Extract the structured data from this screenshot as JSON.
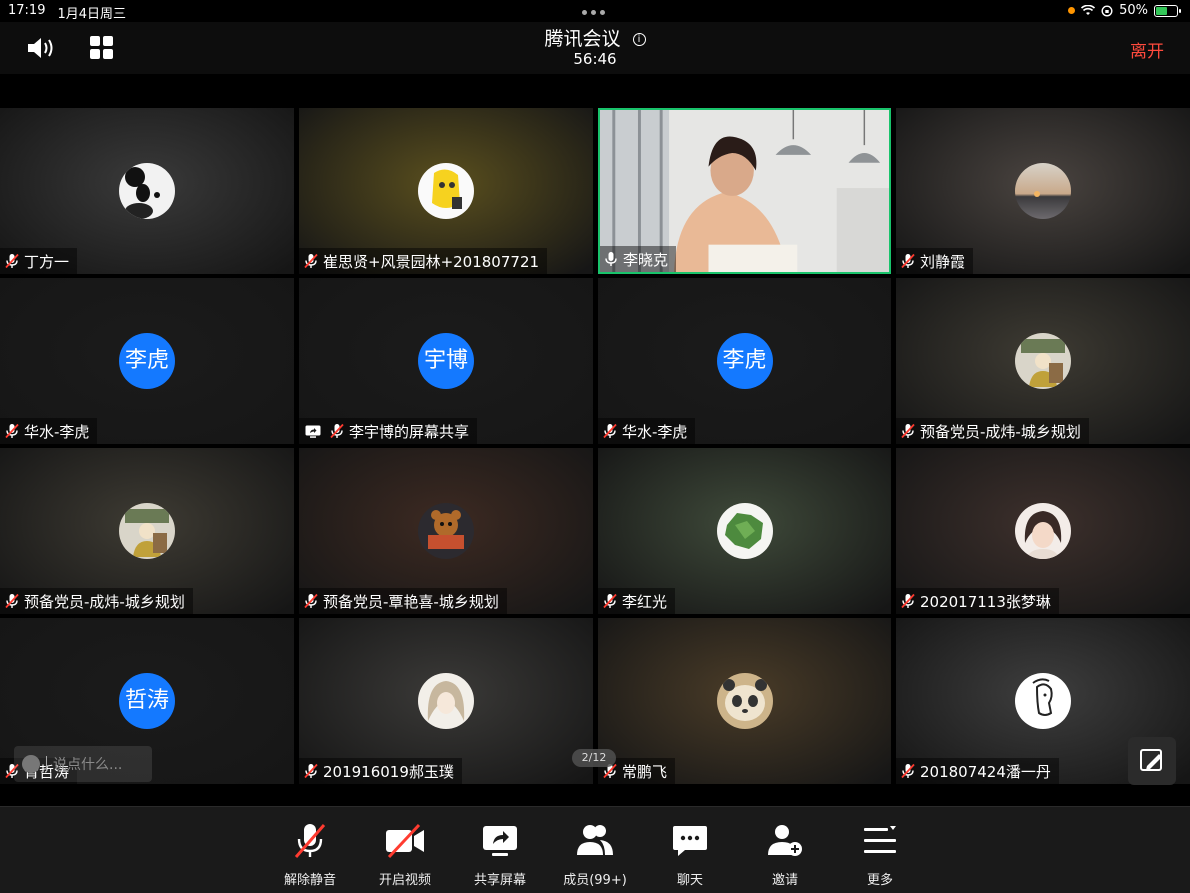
{
  "status_bar": {
    "time": "17:19",
    "date": "1月4日周三",
    "battery": "50%"
  },
  "meeting": {
    "title": "腾讯会议",
    "info_glyph": "i",
    "timer": "56:46",
    "leave_label": "离开"
  },
  "participants": [
    {
      "name": "丁方一",
      "avatar": "panda-photo",
      "mic": "muted",
      "bg": "#3a3a3a"
    },
    {
      "name": "崔思贤+风景园林+201807721",
      "avatar": "yellow-cartoon-photo",
      "mic": "muted",
      "bg": "#5a4f1e"
    },
    {
      "name": "李晓克",
      "avatar": "live-video",
      "mic": "on",
      "bg": "#8e8f8a"
    },
    {
      "name": "刘静霞",
      "avatar": "sunset-photo",
      "mic": "muted",
      "bg": "#4a4440"
    },
    {
      "name": "华水-李虎",
      "avatar_text": "李虎",
      "mic": "muted",
      "bg": "#1b1b1b"
    },
    {
      "name": "李宇博的屏幕共享",
      "avatar_text": "宇博",
      "mic": "muted",
      "sharing": true,
      "bg": "#1b1b1b"
    },
    {
      "name": "华水-李虎",
      "avatar_text": "李虎",
      "mic": "muted",
      "bg": "#1b1b1b"
    },
    {
      "name": "预备党员-成炜-城乡规划",
      "avatar": "cartoon-figure-photo",
      "mic": "muted",
      "bg": "#3e3b33"
    },
    {
      "name": "预备党员-成炜-城乡规划",
      "avatar": "cartoon-figure-photo",
      "mic": "muted",
      "bg": "#3e3b33"
    },
    {
      "name": "预备党员-覃艳喜-城乡规划",
      "avatar": "bear-doll-photo",
      "mic": "muted",
      "bg": "#3d2a22"
    },
    {
      "name": "李红光",
      "avatar": "green-map-photo",
      "mic": "muted",
      "bg": "#3f4a3a"
    },
    {
      "name": "202017113张梦琳",
      "avatar": "girl-photo",
      "mic": "muted",
      "bg": "#3d302c"
    },
    {
      "name": "胥哲涛",
      "avatar_text": "哲涛",
      "mic": "muted",
      "bg": "#1b1b1b"
    },
    {
      "name": "201916019郝玉璞",
      "avatar": "anime-girl-photo",
      "mic": "muted",
      "bg": "#3b3a38"
    },
    {
      "name": "常鹏飞",
      "avatar": "panda-doll-photo",
      "mic": "muted",
      "bg": "#4a3c28"
    },
    {
      "name": "201807424潘一丹",
      "avatar": "line-drawing-photo",
      "mic": "muted",
      "bg": "#3e3e3e"
    }
  ],
  "chat": {
    "placeholder": "说点什么..."
  },
  "page_indicator": "2/12",
  "toolbar": {
    "unmute": "解除静音",
    "video": "开启视频",
    "share": "共享屏幕",
    "members": "成员(99+)",
    "chat": "聊天",
    "invite": "邀请",
    "more": "更多"
  },
  "colors": {
    "accent_blue": "#1479ff",
    "leave_red": "#ff4a3d",
    "active_green": "#19c36b",
    "muted_red": "#ff3b30"
  }
}
